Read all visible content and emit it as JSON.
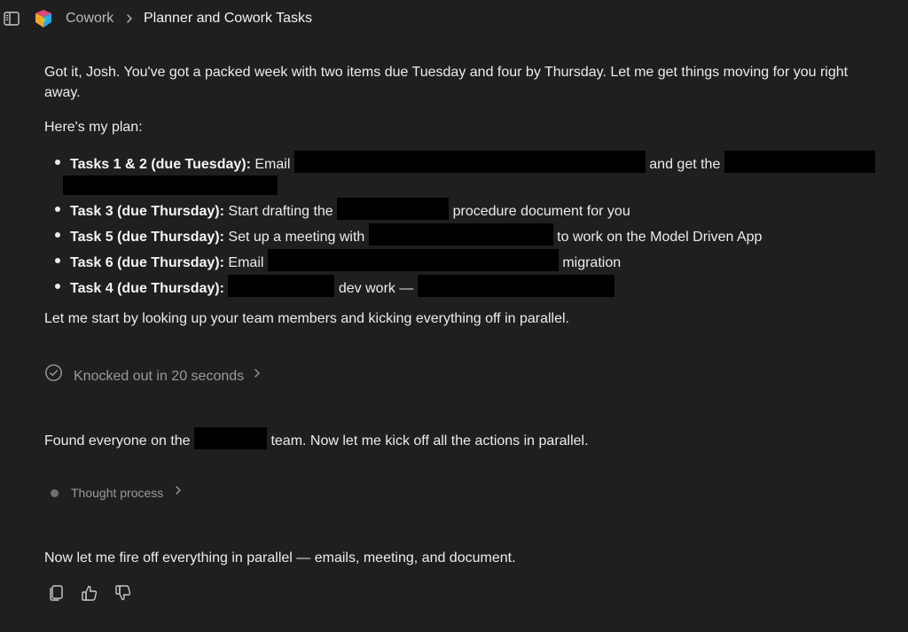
{
  "header": {
    "app_name": "Cowork",
    "page_title": "Planner and Cowork Tasks",
    "icons": [
      "sidebar-toggle-icon",
      "cowork-logo-icon",
      "chevron-right-icon"
    ]
  },
  "message": {
    "intro": "Got it, Josh. You've got a packed week with two items due Tuesday and four by Thursday. Let me get things moving for you right away.",
    "plan_heading": "Here's my plan:",
    "plan_items": [
      {
        "label": "Tasks 1 & 2 (due Tuesday):",
        "part1": " Email ",
        "part2": " and get the "
      },
      {
        "label": "Task 3 (due Thursday):",
        "part1": " Start drafting the ",
        "part2": " procedure document for you"
      },
      {
        "label": "Task 5 (due Thursday):",
        "part1": " Set up a meeting with ",
        "part2": " to work on the Model Driven App"
      },
      {
        "label": "Task 6 (due Thursday):",
        "part1": " Email ",
        "part2": " migration"
      },
      {
        "label": "Task 4 (due Thursday):",
        "part1": " ",
        "part2": " dev work — "
      }
    ],
    "followup": "Let me start by looking up your team members and kicking everything off in parallel.",
    "knocked_out": "Knocked out in 20 seconds",
    "found_part1": "Found everyone on the ",
    "found_part2": " team. Now let me kick off all the actions in parallel.",
    "thought_process": "Thought process",
    "final": "Now let me fire off everything in parallel — emails, meeting, and document."
  },
  "colors": {
    "background": "#1f1f1f",
    "text": "#ececec",
    "muted": "#9a9a9a",
    "redaction": "#000000"
  }
}
